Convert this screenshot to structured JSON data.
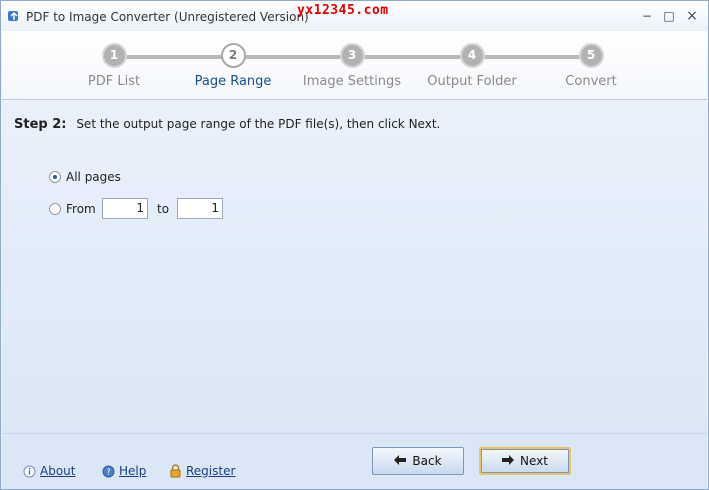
{
  "window": {
    "title": "PDF to Image Converter (Unregistered Version)",
    "watermark": "yx12345.com",
    "controls": [
      "−",
      "□",
      "×"
    ]
  },
  "steps": [
    {
      "number": "1",
      "label": "PDF List",
      "active": false
    },
    {
      "number": "2",
      "label": "Page Range",
      "active": true
    },
    {
      "number": "3",
      "label": "Image Settings",
      "active": false
    },
    {
      "number": "4",
      "label": "Output Folder",
      "active": false
    },
    {
      "number": "5",
      "label": "Convert",
      "active": false
    }
  ],
  "main": {
    "step_title": "Step 2:",
    "instruction": "Set the output page range of the PDF file(s), then click Next.",
    "all_pages_label": "All pages",
    "all_pages_selected": true,
    "from_label": "From",
    "from_value": "1",
    "to_label": "to",
    "to_value": "1"
  },
  "footer": {
    "about_label": "About",
    "help_label": "Help",
    "register_label": "Register",
    "back_label": "Back",
    "next_label": "Next"
  },
  "colors": {
    "accent_text": "#1a4d8c",
    "link": "#1b3f8a",
    "watermark": "#e00000"
  }
}
